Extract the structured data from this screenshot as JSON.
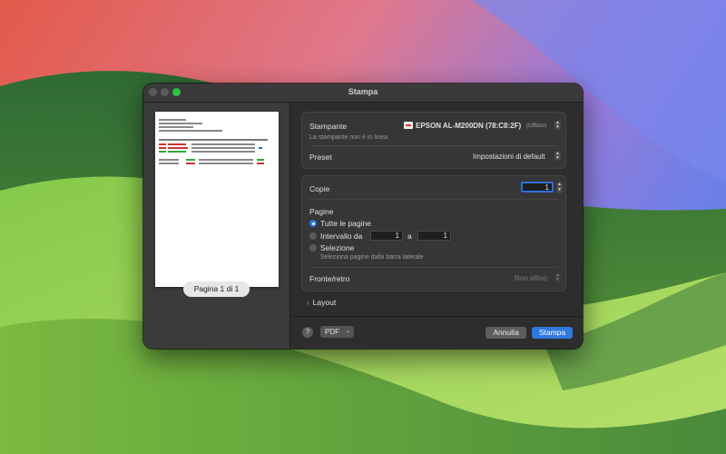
{
  "window": {
    "title": "Stampa"
  },
  "preview": {
    "page_label": "Pagina 1 di 1"
  },
  "printer": {
    "label": "Stampante",
    "name": "EPSON AL-M200DN (78:C8:2F)",
    "location": "(Ufficio)",
    "status": "La stampante non è in linea."
  },
  "preset": {
    "label": "Preset",
    "value": "Impostazioni di default"
  },
  "copies": {
    "label": "Copie",
    "value": "1"
  },
  "pages": {
    "label": "Pagine",
    "all_label": "Tutte le pagine",
    "range_label": "Intervallo da",
    "range_from": "1",
    "range_to_label": "a",
    "range_to": "1",
    "selection_label": "Selezione",
    "selection_hint": "Seleziona pagine dalla barra laterale",
    "selected_option": "Tutte le pagine"
  },
  "duplex": {
    "label": "Fronte/retro",
    "value": "Non attivo"
  },
  "layout": {
    "label": "Layout"
  },
  "footer": {
    "help": "?",
    "pdf_label": "PDF",
    "cancel_label": "Annulla",
    "print_label": "Stampa"
  },
  "colors": {
    "accent": "#2f78e0",
    "zoom_button": "#2fc046"
  }
}
